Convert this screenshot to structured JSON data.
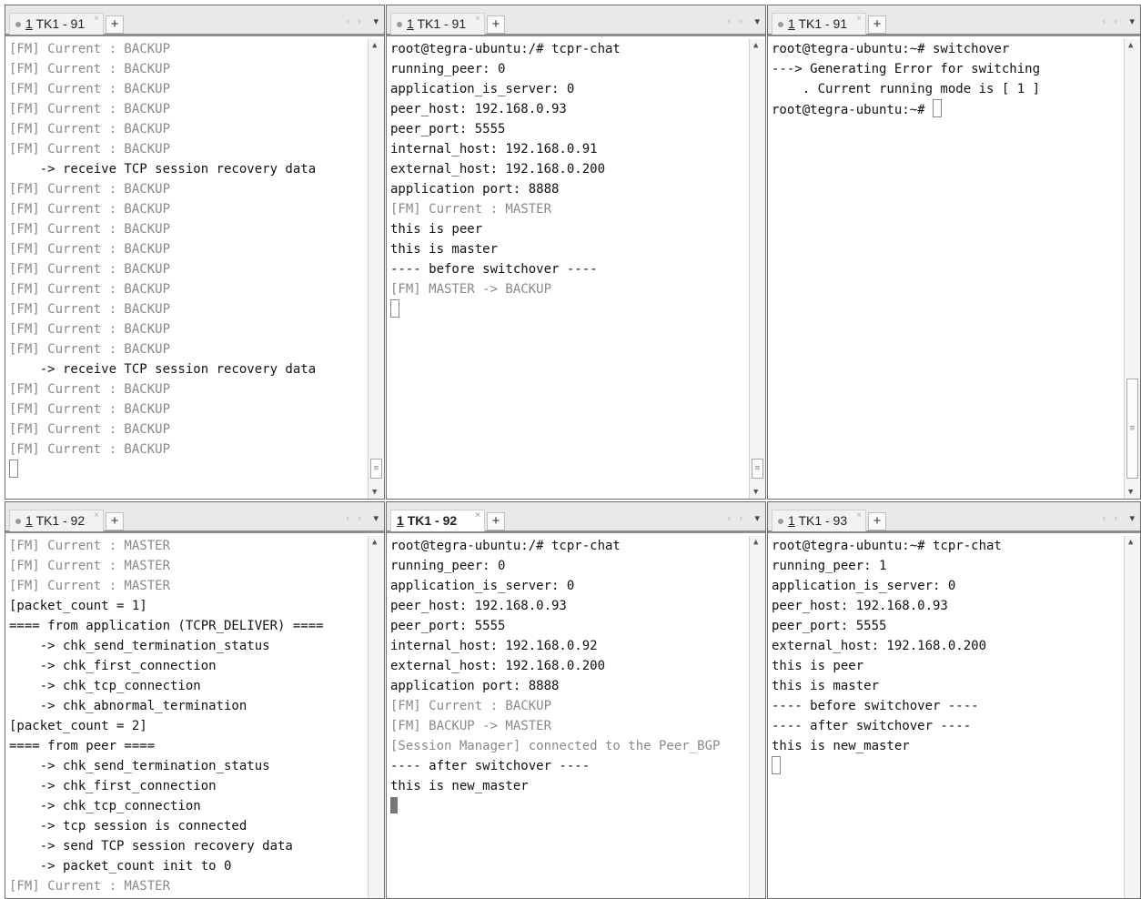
{
  "panes": [
    {
      "tab": {
        "num": "1",
        "title": "TK1 - 91",
        "close": "×",
        "active": false
      },
      "new_tab": "+",
      "nav": "‹ ›",
      "menu": "▾",
      "lines": [
        {
          "t": "[FM] Current : BACKUP",
          "dim": true
        },
        {
          "t": "[FM] Current : BACKUP",
          "dim": true
        },
        {
          "t": "[FM] Current : BACKUP",
          "dim": true
        },
        {
          "t": "[FM] Current : BACKUP",
          "dim": true
        },
        {
          "t": "[FM] Current : BACKUP",
          "dim": true
        },
        {
          "t": "[FM] Current : BACKUP",
          "dim": true
        },
        {
          "t": "    -> receive TCP session recovery data",
          "dim": false
        },
        {
          "t": "[FM] Current : BACKUP",
          "dim": true
        },
        {
          "t": "[FM] Current : BACKUP",
          "dim": true
        },
        {
          "t": "[FM] Current : BACKUP",
          "dim": true
        },
        {
          "t": "[FM] Current : BACKUP",
          "dim": true
        },
        {
          "t": "[FM] Current : BACKUP",
          "dim": true
        },
        {
          "t": "[FM] Current : BACKUP",
          "dim": true
        },
        {
          "t": "[FM] Current : BACKUP",
          "dim": true
        },
        {
          "t": "[FM] Current : BACKUP",
          "dim": true
        },
        {
          "t": "[FM] Current : BACKUP",
          "dim": true
        },
        {
          "t": "    -> receive TCP session recovery data",
          "dim": false
        },
        {
          "t": "[FM] Current : BACKUP",
          "dim": true
        },
        {
          "t": "[FM] Current : BACKUP",
          "dim": true
        },
        {
          "t": "[FM] Current : BACKUP",
          "dim": true
        },
        {
          "t": "[FM] Current : BACKUP",
          "dim": true
        }
      ],
      "cursor": "outline",
      "scrollbar": {
        "thumb": "bottom"
      }
    },
    {
      "tab": {
        "num": "1",
        "title": "TK1 - 91",
        "close": "×",
        "active": false
      },
      "new_tab": "+",
      "nav": "‹ ›",
      "menu": "▾",
      "lines": [
        {
          "t": "root@tegra-ubuntu:/# tcpr-chat",
          "dim": false
        },
        {
          "t": "running_peer: 0",
          "dim": false
        },
        {
          "t": "application_is_server: 0",
          "dim": false
        },
        {
          "t": "peer_host: 192.168.0.93",
          "dim": false
        },
        {
          "t": "peer_port: 5555",
          "dim": false
        },
        {
          "t": "internal_host: 192.168.0.91",
          "dim": false
        },
        {
          "t": "external_host: 192.168.0.200",
          "dim": false
        },
        {
          "t": "application port: 8888",
          "dim": false
        },
        {
          "t": "[FM] Current : MASTER",
          "dim": true
        },
        {
          "t": "this is peer",
          "dim": false
        },
        {
          "t": "this is master",
          "dim": false
        },
        {
          "t": "---- before switchover ----",
          "dim": false
        },
        {
          "t": "[FM] MASTER -> BACKUP",
          "dim": true
        }
      ],
      "cursor": "outline",
      "scrollbar": {
        "thumb": "bottom"
      }
    },
    {
      "tab": {
        "num": "1",
        "title": "TK1 - 91",
        "close": "×",
        "active": false
      },
      "new_tab": "+",
      "nav": "‹ ›",
      "menu": "▾",
      "lines": [
        {
          "t": "root@tegra-ubuntu:~# switchover",
          "dim": false
        },
        {
          "t": "---> Generating Error for switching",
          "dim": false
        },
        {
          "t": "    . Current running mode is [ 1 ]",
          "dim": false
        },
        {
          "t": "root@tegra-ubuntu:~# ",
          "dim": false,
          "cursor": "outline"
        }
      ],
      "cursor": "inline",
      "scrollbar": {
        "thumb": "bottom-large"
      }
    },
    {
      "tab": {
        "num": "1",
        "title": "TK1 - 92",
        "close": "×",
        "active": false
      },
      "new_tab": "+",
      "nav": "‹ ›",
      "menu": "▾",
      "lines": [
        {
          "t": "[FM] Current : MASTER",
          "dim": true
        },
        {
          "t": "[FM] Current : MASTER",
          "dim": true
        },
        {
          "t": "[FM] Current : MASTER",
          "dim": true
        },
        {
          "t": "[packet_count = 1]",
          "dim": false
        },
        {
          "t": "==== from application (TCPR_DELIVER) ====",
          "dim": false
        },
        {
          "t": "    -> chk_send_termination_status",
          "dim": false
        },
        {
          "t": "    -> chk_first_connection",
          "dim": false
        },
        {
          "t": "    -> chk_tcp_connection",
          "dim": false
        },
        {
          "t": "    -> chk_abnormal_termination",
          "dim": false
        },
        {
          "t": "[packet_count = 2]",
          "dim": false
        },
        {
          "t": "==== from peer ====",
          "dim": false
        },
        {
          "t": "    -> chk_send_termination_status",
          "dim": false
        },
        {
          "t": "    -> chk_first_connection",
          "dim": false
        },
        {
          "t": "    -> chk_tcp_connection",
          "dim": false
        },
        {
          "t": "    -> tcp session is connected",
          "dim": false
        },
        {
          "t": "    -> send TCP session recovery data",
          "dim": false
        },
        {
          "t": "    -> packet_count init to 0",
          "dim": false
        },
        {
          "t": "[FM] Current : MASTER",
          "dim": true
        }
      ],
      "cursor": "none",
      "scrollbar": {
        "thumb": "none"
      }
    },
    {
      "tab": {
        "num": "1",
        "title": "TK1 - 92",
        "close": "×",
        "active": true
      },
      "new_tab": "+",
      "nav": "‹ ›",
      "menu": "▾",
      "lines": [
        {
          "t": "root@tegra-ubuntu:/# tcpr-chat",
          "dim": false
        },
        {
          "t": "running_peer: 0",
          "dim": false
        },
        {
          "t": "application_is_server: 0",
          "dim": false
        },
        {
          "t": "peer_host: 192.168.0.93",
          "dim": false
        },
        {
          "t": "peer_port: 5555",
          "dim": false
        },
        {
          "t": "internal_host: 192.168.0.92",
          "dim": false
        },
        {
          "t": "external_host: 192.168.0.200",
          "dim": false
        },
        {
          "t": "application port: 8888",
          "dim": false
        },
        {
          "t": "[FM] Current : BACKUP",
          "dim": true
        },
        {
          "t": "[FM] BACKUP -> MASTER",
          "dim": true
        },
        {
          "t": "[Session Manager] connected to the Peer_BGP",
          "dim": true
        },
        {
          "t": "---- after switchover ----",
          "dim": false
        },
        {
          "t": "this is new_master",
          "dim": false
        }
      ],
      "cursor": "solid",
      "scrollbar": {
        "thumb": "none"
      }
    },
    {
      "tab": {
        "num": "1",
        "title": "TK1 - 93",
        "close": "×",
        "active": false
      },
      "new_tab": "+",
      "nav": "‹ ›",
      "menu": "▾",
      "lines": [
        {
          "t": "root@tegra-ubuntu:~# tcpr-chat",
          "dim": false
        },
        {
          "t": "running_peer: 1",
          "dim": false
        },
        {
          "t": "application_is_server: 0",
          "dim": false
        },
        {
          "t": "peer_host: 192.168.0.93",
          "dim": false
        },
        {
          "t": "peer_port: 5555",
          "dim": false
        },
        {
          "t": "external_host: 192.168.0.200",
          "dim": false
        },
        {
          "t": "this is peer",
          "dim": false
        },
        {
          "t": "this is master",
          "dim": false
        },
        {
          "t": "---- before switchover ----",
          "dim": false
        },
        {
          "t": "---- after switchover ----",
          "dim": false
        },
        {
          "t": "this is new_master",
          "dim": false
        }
      ],
      "cursor": "outline",
      "scrollbar": {
        "thumb": "none"
      }
    }
  ]
}
